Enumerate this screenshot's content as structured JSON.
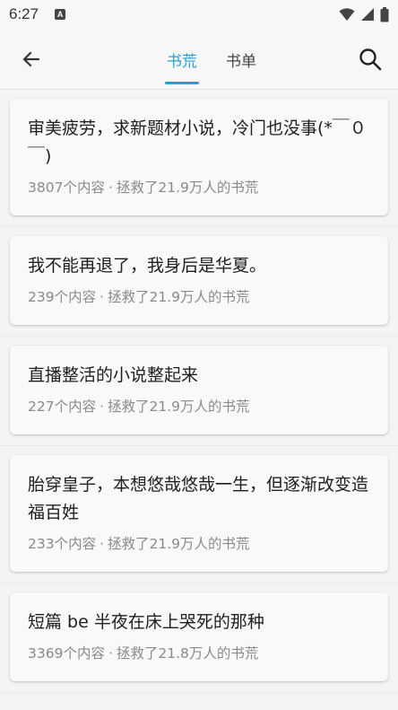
{
  "status_bar": {
    "time": "6:27",
    "notification_badge": "A",
    "icons": [
      "wifi-icon",
      "signal-icon",
      "battery-icon"
    ]
  },
  "header": {
    "back_icon": "arrow-left-icon",
    "search_icon": "search-icon",
    "tabs": [
      {
        "label": "书荒",
        "active": true
      },
      {
        "label": "书单",
        "active": false
      }
    ]
  },
  "accent_color": "#27a0d6",
  "cards": [
    {
      "title": "审美疲劳，求新题材小说，冷门也没事(*￣０￣)",
      "count": "3807个内容",
      "saved": "拯救了21.9万人的书荒"
    },
    {
      "title": "我不能再退了，我身后是华夏。",
      "count": "239个内容",
      "saved": "拯救了21.9万人的书荒"
    },
    {
      "title": "直播整活的小说整起来",
      "count": "227个内容",
      "saved": "拯救了21.9万人的书荒"
    },
    {
      "title": "胎穿皇子，本想悠哉悠哉一生，但逐渐改变造福百姓",
      "count": "233个内容",
      "saved": "拯救了21.9万人的书荒"
    },
    {
      "title": "短篇 be 半夜在床上哭死的那种",
      "count": "3369个内容",
      "saved": "拯救了21.8万人的书荒"
    }
  ]
}
